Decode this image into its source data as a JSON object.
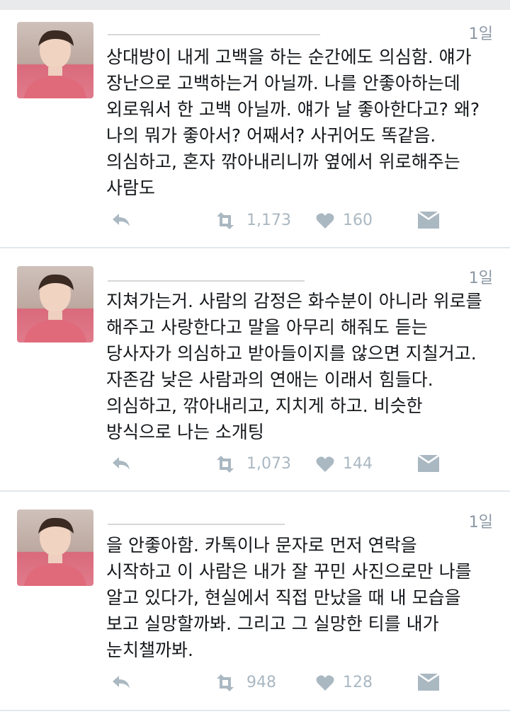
{
  "tweets": [
    {
      "time": "1일",
      "text": "상대방이 내게 고백을 하는 순간에도 의심함. 얘가\n장난으로 고백하는거 아닐까. 나를 안좋아하는데\n외로워서 한 고백 아닐까. 얘가 날 좋아한다고? 왜?\n나의 뭐가 좋아서? 어째서? 사귀어도 똑같음.\n의심하고, 혼자 깎아내리니까 옆에서 위로해주는\n사람도",
      "retweets": "1,173",
      "likes": "160"
    },
    {
      "time": "1일",
      "text": "지쳐가는거. 사람의 감정은 화수분이 아니라 위로를\n해주고 사랑한다고 말을 아무리 해줘도 듣는\n당사자가 의심하고 받아들이지를 않으면 지칠거고.\n자존감 낮은 사람과의 연애는 이래서 힘들다.\n의심하고, 깎아내리고, 지치게 하고. 비슷한\n방식으로 나는 소개팅",
      "retweets": "1,073",
      "likes": "144"
    },
    {
      "time": "1일",
      "text": "을 안좋아함. 카톡이나 문자로 먼저 연락을\n시작하고 이 사람은 내가 잘 꾸민 사진으로만 나를\n알고 있다가, 현실에서 직접 만났을 때 내 모습을\n보고 실망할까봐. 그리고 그 실망한 티를 내가\n눈치챌까봐.",
      "retweets": "948",
      "likes": "128"
    }
  ],
  "icons": {
    "reply": "reply-icon",
    "retweet": "retweet-icon",
    "like": "heart-icon",
    "dm": "envelope-icon"
  },
  "colors": {
    "text": "#14171a",
    "meta": "#8b98a5",
    "action": "#aab8c2",
    "separator": "#e1e8ed"
  }
}
